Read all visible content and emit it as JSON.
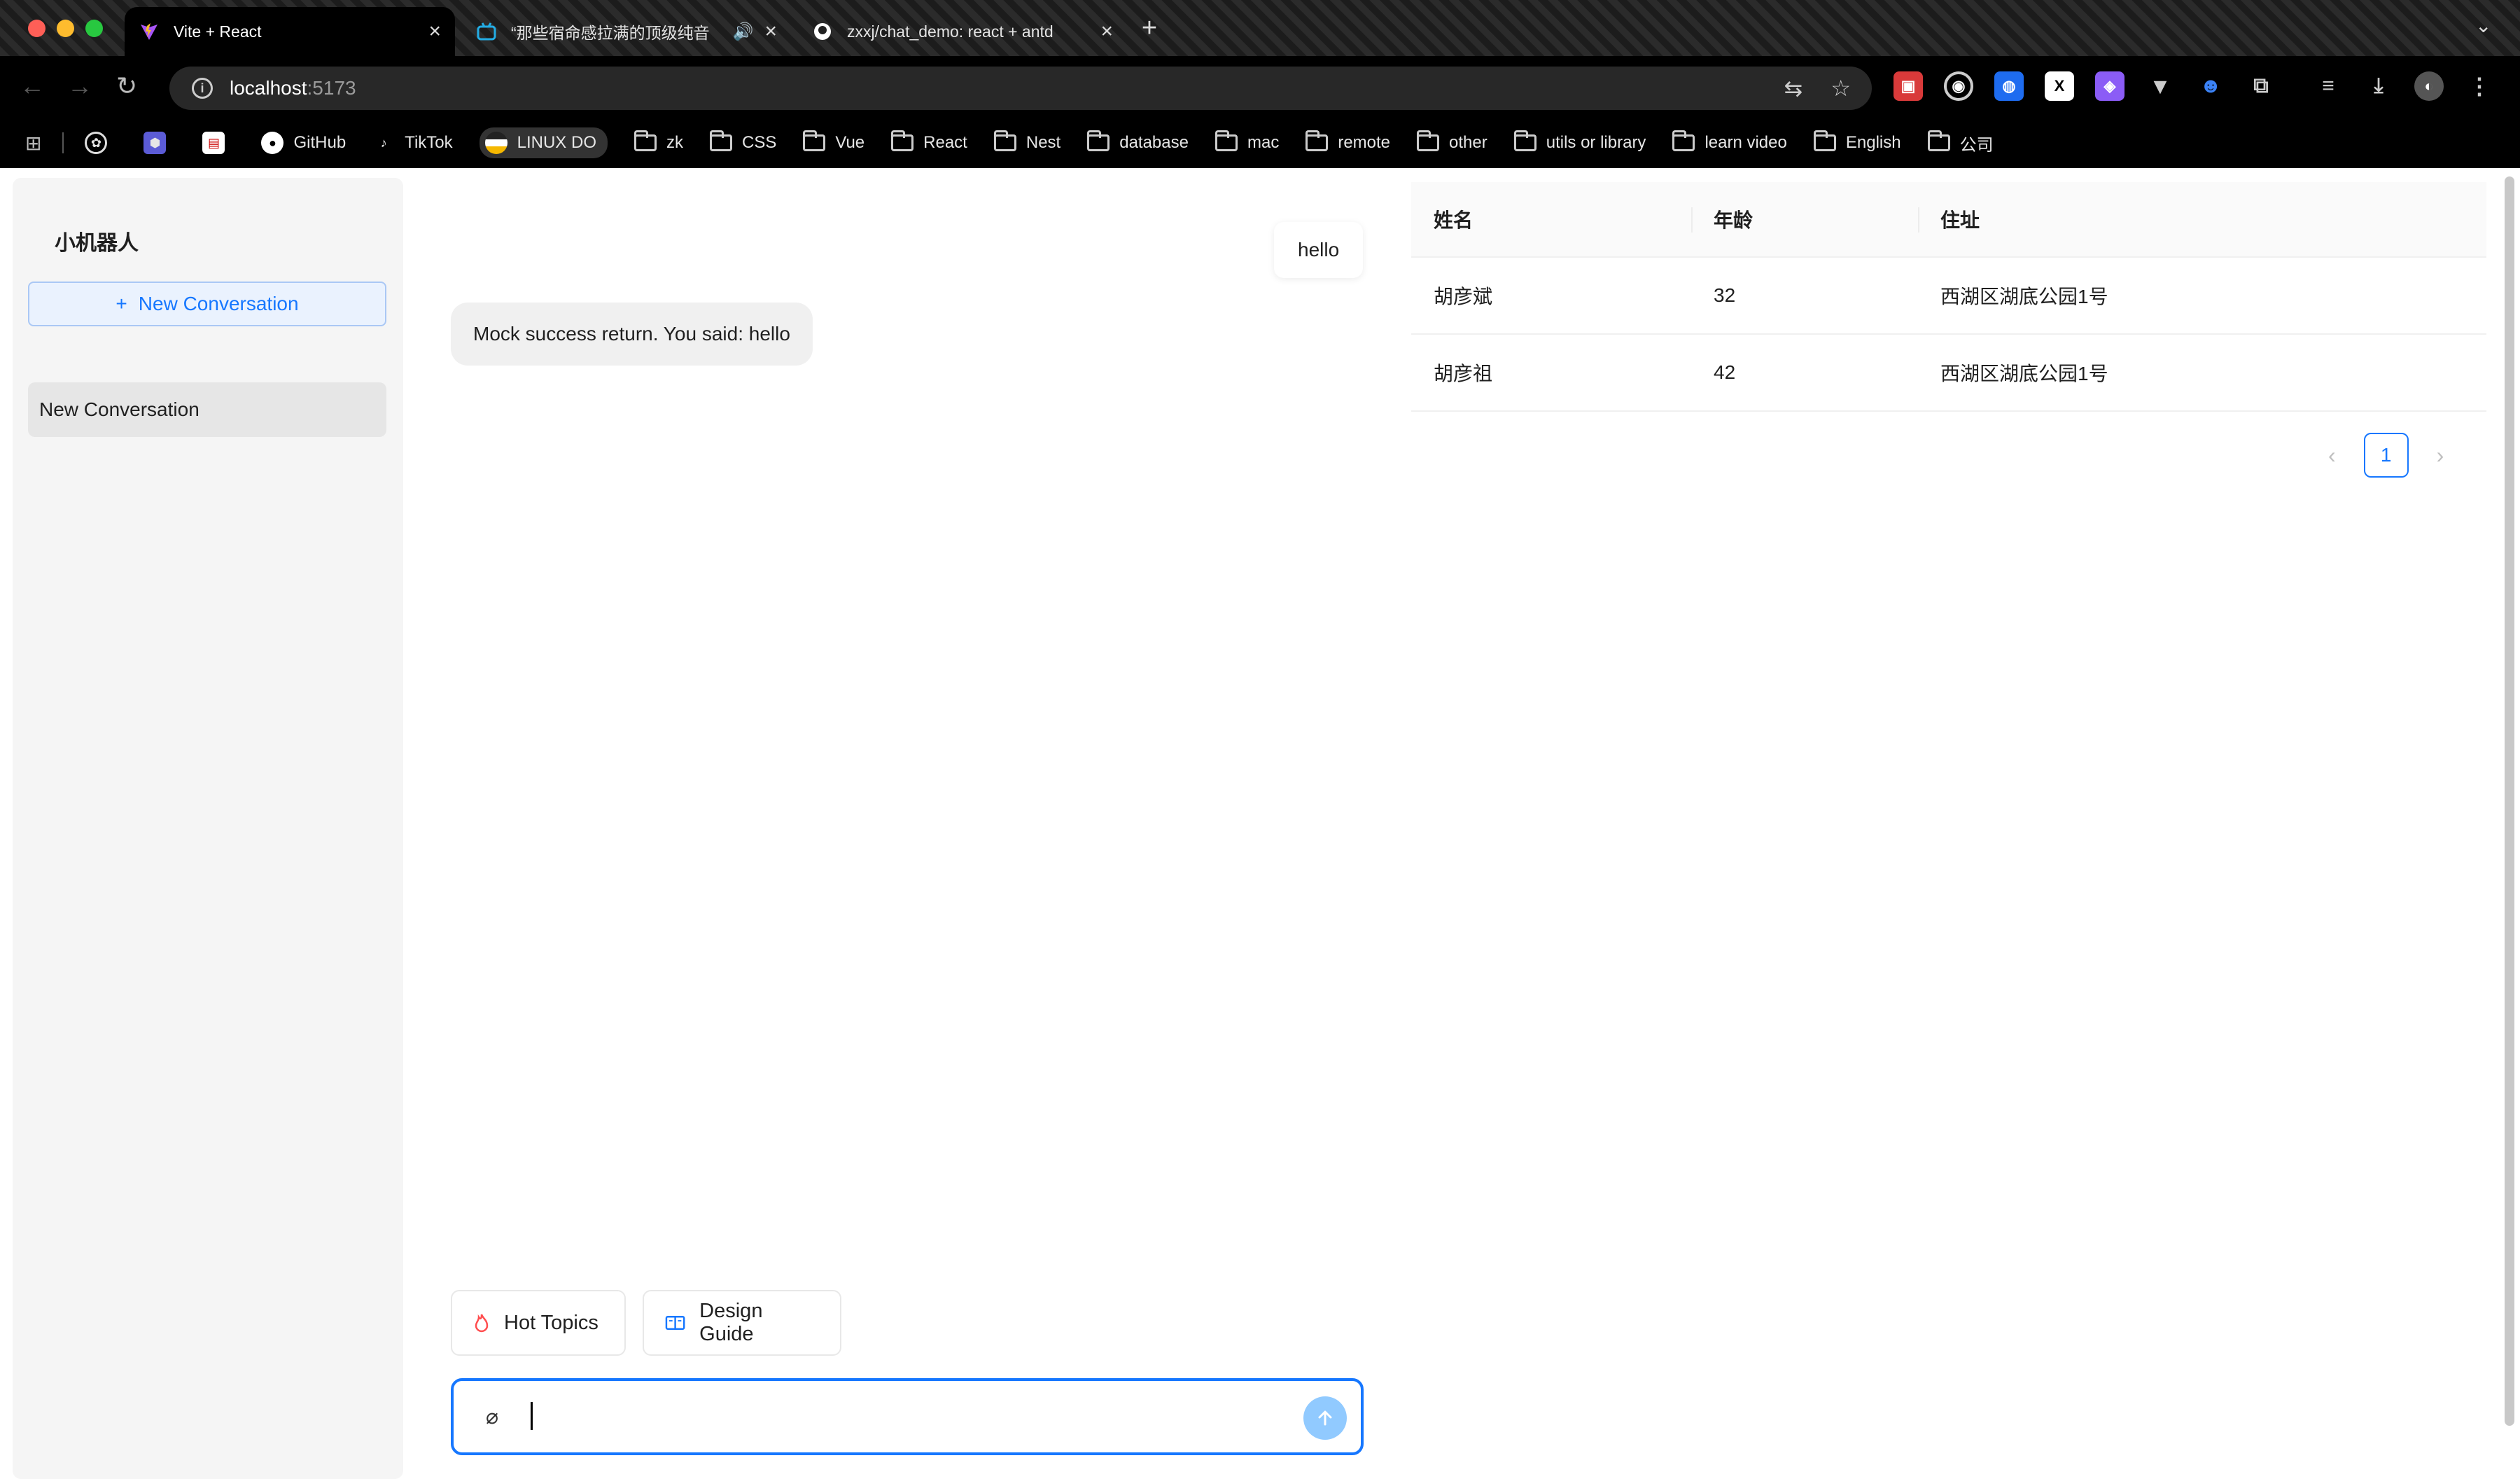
{
  "browser": {
    "tabs": [
      {
        "title": "Vite + React",
        "active": true
      },
      {
        "title": "“那些宿命感拉满的顶级纯音",
        "active": false
      },
      {
        "title": "zxxj/chat_demo: react + antd",
        "active": false
      }
    ],
    "url_host": "localhost",
    "url_port": ":5173",
    "extensions": [
      "red-ext-icon",
      "target-ext-icon",
      "blue-ext-icon",
      "x-ext-icon",
      "purple-ext-icon",
      "vue-ext-icon",
      "owl-ext-icon",
      "puzzle-icon"
    ],
    "bookmarks": [
      {
        "label": "",
        "icon": "openai-icon"
      },
      {
        "label": "",
        "icon": "cube-icon"
      },
      {
        "label": "",
        "icon": "doc-icon"
      },
      {
        "label": "GitHub",
        "icon": "github-icon"
      },
      {
        "label": "TikTok",
        "icon": "tiktok-icon"
      },
      {
        "label": "LINUX DO",
        "icon": "linuxdo-icon"
      },
      {
        "label": "zk",
        "icon": "folder-icon"
      },
      {
        "label": "CSS",
        "icon": "folder-icon"
      },
      {
        "label": "Vue",
        "icon": "folder-icon"
      },
      {
        "label": "React",
        "icon": "folder-icon"
      },
      {
        "label": "Nest",
        "icon": "folder-icon"
      },
      {
        "label": "database",
        "icon": "folder-icon"
      },
      {
        "label": "mac",
        "icon": "folder-icon"
      },
      {
        "label": "remote",
        "icon": "folder-icon"
      },
      {
        "label": "other",
        "icon": "folder-icon"
      },
      {
        "label": "utils or library",
        "icon": "folder-icon"
      },
      {
        "label": "learn video",
        "icon": "folder-icon"
      },
      {
        "label": "English",
        "icon": "folder-icon"
      },
      {
        "label": "公司",
        "icon": "folder-icon"
      }
    ]
  },
  "sidebar": {
    "brand": "小机器人",
    "new_button": "New Conversation",
    "conversations": [
      {
        "label": "New Conversation"
      }
    ]
  },
  "chat": {
    "messages": [
      {
        "role": "user",
        "text": "hello"
      },
      {
        "role": "assistant",
        "text": "Mock success return. You said: hello"
      }
    ],
    "prompts": [
      {
        "label": "Hot Topics",
        "icon": "fire-icon"
      },
      {
        "label": "Design Guide",
        "icon": "book-icon"
      }
    ],
    "input_value": ""
  },
  "table": {
    "columns": [
      "姓名",
      "年龄",
      "住址"
    ],
    "rows": [
      [
        "胡彦斌",
        "32",
        "西湖区湖底公园1号"
      ],
      [
        "胡彦祖",
        "42",
        "西湖区湖底公园1号"
      ]
    ],
    "current_page": "1"
  },
  "colors": {
    "accent": "#1677ff",
    "send_disabled": "#91caff"
  }
}
